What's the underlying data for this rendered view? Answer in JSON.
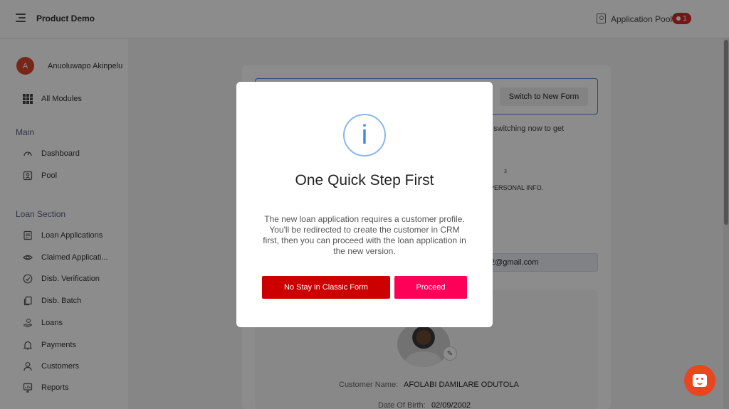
{
  "topbar": {
    "title": "Product Demo",
    "pool_label": "Application Pool",
    "pool_count": "1"
  },
  "sidebar": {
    "user_initial": "A",
    "user_name": "Anuoluwapo Akinpelu",
    "all_modules": "All Modules",
    "section_main": "Main",
    "main_items": [
      {
        "label": "Dashboard",
        "icon": "dashboard-icon"
      },
      {
        "label": "Pool",
        "icon": "pool-icon"
      }
    ],
    "section_loan": "Loan Section",
    "loan_items": [
      {
        "label": "Loan Applications",
        "icon": "document-icon"
      },
      {
        "label": "Claimed Applicati...",
        "icon": "eye-icon"
      },
      {
        "label": "Disb. Verification",
        "icon": "check-circle-icon"
      },
      {
        "label": "Disb. Batch",
        "icon": "copy-icon"
      },
      {
        "label": "Loans",
        "icon": "hand-coin-icon"
      },
      {
        "label": "Payments",
        "icon": "bell-icon"
      },
      {
        "label": "Customers",
        "icon": "user-icon"
      },
      {
        "label": "Reports",
        "icon": "report-icon"
      }
    ]
  },
  "main": {
    "switch_button": "Switch to New Form",
    "switch_note": "d switching now to get",
    "step_number": "3",
    "step_label": "PERSONAL INFO.",
    "email_value": "2@gmail.com",
    "customer_name_label": "Customer Name:",
    "customer_name_value": "AFOLABI DAMILARE ODUTOLA",
    "dob_label": "Date Of Birth:",
    "dob_value": "02/09/2002"
  },
  "modal": {
    "icon": "info-icon",
    "icon_glyph": "i",
    "title": "One Quick Step First",
    "text": "The new loan application requires a customer profile. You'll be redirected to create the customer in CRM first, then you can proceed with the loan application in the new version.",
    "stay_button": "No Stay in Classic Form",
    "proceed_button": "Proceed"
  },
  "colors": {
    "stay_button": "#cc0000",
    "proceed_button": "#ff0059",
    "info_icon": "#3a86e0",
    "chat_button": "#e8461f",
    "badge": "#d72a2a"
  }
}
